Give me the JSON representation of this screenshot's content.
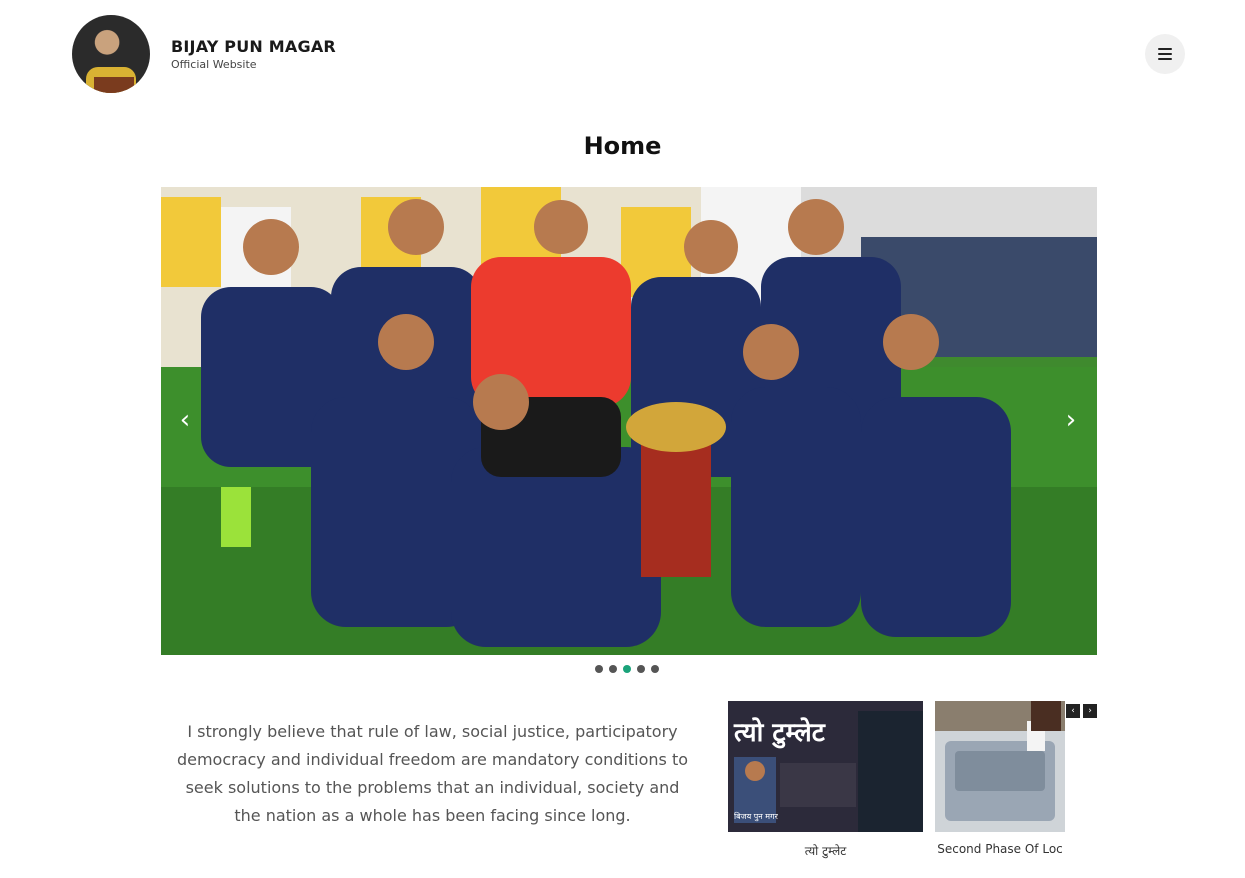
{
  "header": {
    "name": "BIJAY PUN MAGAR",
    "tagline": "Official Website",
    "menu_icon": "hamburger-icon"
  },
  "page": {
    "title": "Home"
  },
  "slider": {
    "prev_icon": "chevron-left-icon",
    "next_icon": "chevron-right-icon",
    "prev_label": "‹",
    "next_label": "›",
    "slide_count": 5,
    "active_index": 2
  },
  "intro": {
    "quote": "I strongly believe that rule of law, social justice, participatory democracy and individual freedom are mandatory conditions to seek solutions to the problems that an individual, society and the nation as a whole has been facing since long."
  },
  "thumbnails": {
    "items": [
      {
        "caption": "त्यो टुम्लेट",
        "overlay_title": "त्यो टुम्लेट",
        "overlay_name": "बिजय पुन मगर"
      },
      {
        "caption": "Second Phase Of Loc"
      }
    ],
    "prev_label": "‹",
    "next_label": "›"
  },
  "colors": {
    "accent": "#1aa37a",
    "dot": "#555555"
  }
}
